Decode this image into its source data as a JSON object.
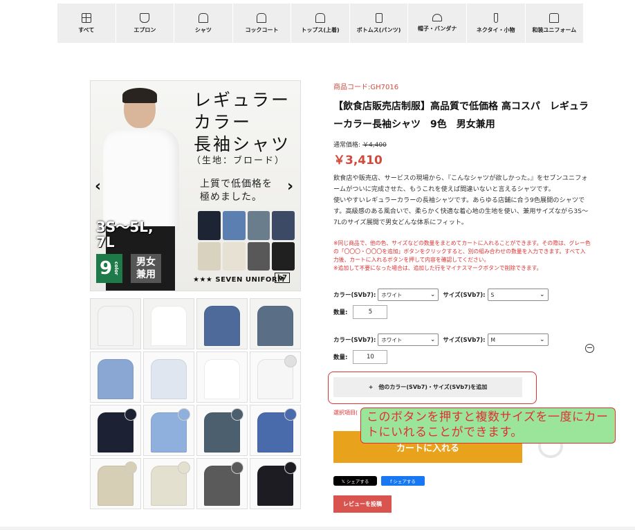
{
  "categories": [
    {
      "label": "すべて",
      "icon": "grid-icon"
    },
    {
      "label": "エプロン",
      "icon": "apron-icon"
    },
    {
      "label": "シャツ",
      "icon": "shirt-icon"
    },
    {
      "label": "コックコート",
      "icon": "chef-coat-icon"
    },
    {
      "label": "トップス(上着)",
      "icon": "jacket-icon"
    },
    {
      "label": "ボトムス(パンツ)",
      "icon": "pants-icon"
    },
    {
      "label": "帽子・バンダナ",
      "icon": "hat-icon"
    },
    {
      "label": "ネクタイ・小物",
      "icon": "necktie-icon"
    },
    {
      "label": "和装ユニフォーム",
      "icon": "kimono-icon"
    }
  ],
  "hero": {
    "headline": [
      "レギュラー",
      "カラー",
      "長袖シャツ"
    ],
    "fabric": "（生地：ブロード）",
    "tagline": [
      "上質で低価格を",
      "極めました。"
    ],
    "sizes": [
      "3S～5L,",
      "7L"
    ],
    "colors_count": "9",
    "colors_word": "color",
    "unisex": [
      "男女",
      "兼用"
    ],
    "brand": "SEVEN UNIFORM",
    "brand_mark": "b7",
    "prev_arrow": "‹",
    "next_arrow": "›",
    "shirt_colors": [
      "#1d2434",
      "#5b7fb0",
      "#6a7d8c",
      "#3d4a66",
      "#d9d2bf",
      "#e6e1d2",
      "#585858",
      "#202020"
    ]
  },
  "thumbnails": [
    {
      "color": "#f4f4f4",
      "dot": ""
    },
    {
      "color": "#ffffff",
      "dot": ""
    },
    {
      "color": "#4d6a9a",
      "dot": ""
    },
    {
      "color": "#5a6f86",
      "dot": ""
    },
    {
      "color": "#8aa7d4",
      "dot": ""
    },
    {
      "color": "#dfe6ef",
      "dot": ""
    },
    {
      "color": "#ffffff",
      "dot": ""
    },
    {
      "color": "#f6f6f6",
      "dot": "#e0e0e0"
    },
    {
      "color": "#1c2233",
      "dot": "#1c2233"
    },
    {
      "color": "#8fb0dc",
      "dot": "#8fb0dc"
    },
    {
      "color": "#4c5f6f",
      "dot": "#4c5f6f"
    },
    {
      "color": "#4a6bab",
      "dot": "#4a6bab"
    },
    {
      "color": "#d7ceb6",
      "dot": "#d7ceb6"
    },
    {
      "color": "#e4e0cf",
      "dot": "#e4e0cf"
    },
    {
      "color": "#5a5a5a",
      "dot": "#5a5a5a"
    },
    {
      "color": "#1c1c22",
      "dot": "#1c1c22"
    }
  ],
  "product": {
    "code": "商品コード:GH7016",
    "title": "【飲食店販売店制服】高品質で低価格 高コスパ　レギュラーカラー長袖シャツ　9色　男女兼用",
    "regular_label": "通常価格:",
    "regular_price": "￥4,400",
    "price": "￥3,410",
    "description": "飲食店や販売店、サービスの現場から、『こんなシャツが欲しかった。』をセブンユニフォームがついに完成させた、もうこれを使えば間違いないと言えるシャツです。\n使いやすいレギュラーカラーの長袖シャツです。あらゆる店舗に合う9色展開のシャツです。高級感のある風合いで、柔らかく快適な着心地の生地を使い、兼用サイズながら3S〜7Lのサイズ展開で男女どんな体系にフィット。",
    "note": "※同じ商品で、他の色、サイズなどの数量をまとめてカートに入れることができます。その際は、グレー色の「〇〇〇・〇〇〇を追加」ボタンをクリックすると、別の組み合わせの数量を入力できます。すべて入力後、カートに入れるボタンを押して内容を確認してください。\n※追加して不要になった場合は、追加した行をマイナスマークボタンで削除できます。"
  },
  "variants": [
    {
      "color_label": "カラー(SVb7):",
      "color_value": "ホワイト",
      "size_label": "サイズ(SVb7):",
      "size_value": "S",
      "qty_label": "数量:",
      "qty_value": "5"
    },
    {
      "color_label": "カラー(SVb7):",
      "color_value": "ホワイト",
      "size_label": "サイズ(SVb7):",
      "size_value": "M",
      "qty_label": "数量:",
      "qty_value": "10"
    }
  ],
  "actions": {
    "add_variant": "+　他のカラー(SVb7)・サイズ(SVb7)を追加",
    "selected_note": "選択項目(",
    "add_to_cart": "カートに入れる",
    "remove": "−",
    "x_share": "𝕏 シェアする",
    "fb_share": "f シェアする",
    "review": "レビューを投稿"
  },
  "callout": "このボタンを押すと複数サイズを一度にカートにいれることができます。"
}
